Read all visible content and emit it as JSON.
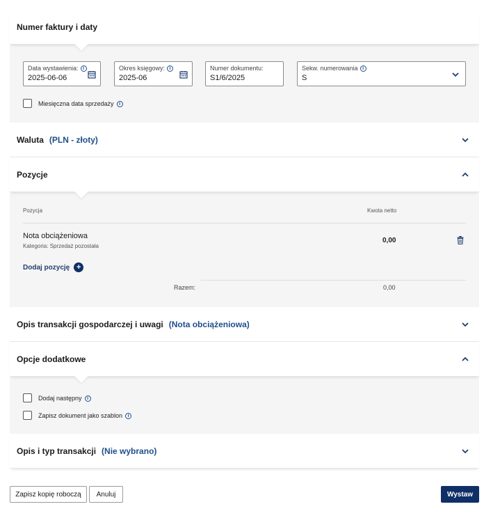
{
  "sections": {
    "dates": {
      "title": "Numer faktury i daty",
      "issue_date": {
        "label": "Data wystawienia:",
        "value": "2025-06-06"
      },
      "period": {
        "label": "Okres księgowy:",
        "value": "2025-06"
      },
      "doc_number": {
        "label": "Numer dokumentu:",
        "value": "S1/6/2025"
      },
      "sequence": {
        "label": "Sekw. numerowania",
        "value": "S"
      },
      "monthly_sale_date": "Miesięczna data sprzedaży"
    },
    "currency": {
      "title": "Waluta",
      "value": "(PLN - złoty)"
    },
    "positions": {
      "title": "Pozycje",
      "col_position": "Pozycja",
      "col_net": "Kwota netto",
      "items": [
        {
          "name": "Nota obciążeniowa",
          "category": "Kategoria: Sprzedaż pozostała",
          "net": "0,00"
        }
      ],
      "add_label": "Dodaj pozycję",
      "add_icon": "+",
      "total_label": "Razem:",
      "total_value": "0,00"
    },
    "description": {
      "title": "Opis transakcji gospodarczej i uwagi",
      "value": "(Nota obciążeniowa)"
    },
    "options": {
      "title": "Opcje dodatkowe",
      "add_next": "Dodaj następny",
      "save_template": "Zapisz dokument jako szablon"
    },
    "transaction": {
      "title": "Opis i typ transakcji",
      "value": "(Nie wybrano)"
    }
  },
  "buttons": {
    "save_draft": "Zapisz kopię roboczą",
    "cancel": "Anuluj",
    "issue": "Wystaw"
  },
  "info_glyph": "i",
  "colors": {
    "accent": "#1f4e8c",
    "primary_button": "#0f2f66",
    "panel_bg": "#f5f5f5"
  }
}
